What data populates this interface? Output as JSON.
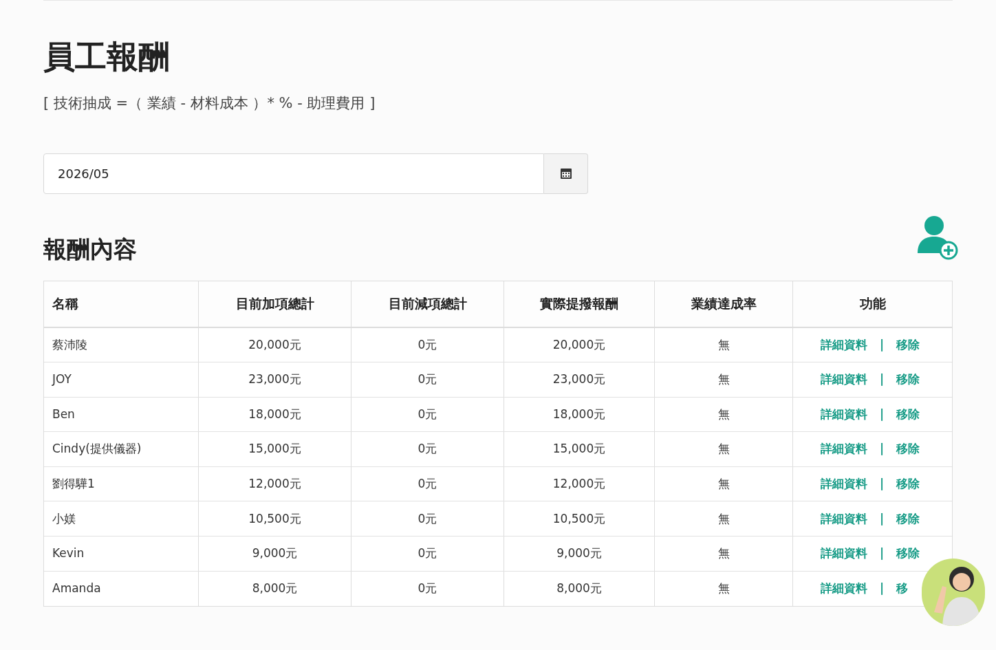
{
  "page_title": "員工報酬",
  "formula": "[ 技術抽成 =（ 業績 - 材料成本 ）* % - 助理費用 ]",
  "month_field": {
    "value": "2026/05"
  },
  "section_title": "報酬內容",
  "table": {
    "columns": [
      "名稱",
      "目前加項總計",
      "目前減項總計",
      "實際提撥報酬",
      "業績達成率",
      "功能"
    ],
    "rows": [
      {
        "name": "蔡沛陵",
        "plus": "20,000元",
        "minus": "0元",
        "actual": "20,000元",
        "rate": "無",
        "detail": "詳細資料",
        "separator": "|",
        "remove": "移除"
      },
      {
        "name": "JOY",
        "plus": "23,000元",
        "minus": "0元",
        "actual": "23,000元",
        "rate": "無",
        "detail": "詳細資料",
        "separator": "|",
        "remove": "移除"
      },
      {
        "name": "Ben",
        "plus": "18,000元",
        "minus": "0元",
        "actual": "18,000元",
        "rate": "無",
        "detail": "詳細資料",
        "separator": "|",
        "remove": "移除"
      },
      {
        "name": "Cindy(提供儀器)",
        "plus": "15,000元",
        "minus": "0元",
        "actual": "15,000元",
        "rate": "無",
        "detail": "詳細資料",
        "separator": "|",
        "remove": "移除"
      },
      {
        "name": "劉得驊1",
        "plus": "12,000元",
        "minus": "0元",
        "actual": "12,000元",
        "rate": "無",
        "detail": "詳細資料",
        "separator": "|",
        "remove": "移除"
      },
      {
        "name": "小媄",
        "plus": "10,500元",
        "minus": "0元",
        "actual": "10,500元",
        "rate": "無",
        "detail": "詳細資料",
        "separator": "|",
        "remove": "移除"
      },
      {
        "name": "Kevin",
        "plus": "9,000元",
        "minus": "0元",
        "actual": "9,000元",
        "rate": "無",
        "detail": "詳細資料",
        "separator": "|",
        "remove": "移除"
      },
      {
        "name": "Amanda",
        "plus": "8,000元",
        "minus": "0元",
        "actual": "8,000元",
        "rate": "無",
        "detail": "詳細資料",
        "separator": "|",
        "remove": "移"
      }
    ]
  }
}
